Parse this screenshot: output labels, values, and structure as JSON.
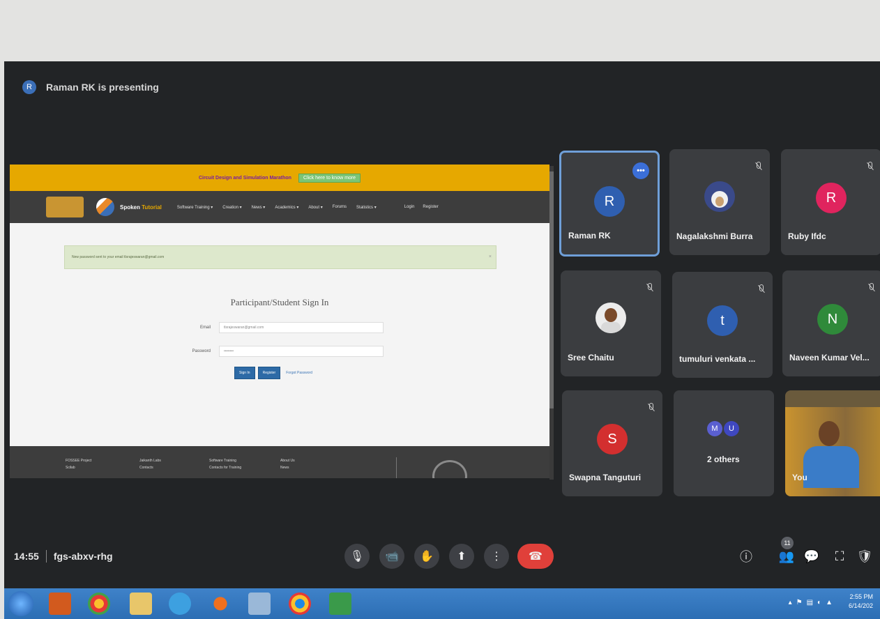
{
  "presenter": {
    "initial": "R",
    "text": "Raman RK is presenting"
  },
  "shared_page": {
    "banner_text": "Circuit Design and Simulation Marathon",
    "banner_button": "Click here to know more",
    "site_name_a": "Spoken",
    "site_name_b": "Tutorial",
    "nav": [
      "Software Training ▾",
      "Creation ▾",
      "News ▾",
      "Academics ▾",
      "About ▾",
      "Forums",
      "Statistics ▾"
    ],
    "nav_right": [
      "Login",
      "Register"
    ],
    "alert_text": "New password sent to your email tlsrajeswaran@gmail.com",
    "signin_title": "Participant/Student Sign In",
    "email_label": "Email",
    "email_value": "tlsrajeswaran@gmail.com",
    "password_label": "Password",
    "password_value": "••••••••",
    "signin_button": "Sign In",
    "register_button": "Register",
    "forgot_link": "Forgot Password",
    "footer_cols": [
      [
        "FOSSEE Project",
        "Scilab"
      ],
      [
        "Jaikanth Labs",
        "Contacts"
      ],
      [
        "Software Training",
        "Contacts for Training"
      ],
      [
        "About Us",
        "News"
      ]
    ]
  },
  "participants": [
    {
      "name": "Raman RK",
      "initial": "R",
      "color": "#2f5fb0",
      "active": true
    },
    {
      "name": "Nagalakshmi Burra",
      "photo": true
    },
    {
      "name": "Ruby Ifdc",
      "initial": "R",
      "color": "#e0245e"
    },
    {
      "name": "Sree Chaitu",
      "photo": true
    },
    {
      "name": "tumuluri venkata ...",
      "initial": "t",
      "color": "#2f5fb0"
    },
    {
      "name": "Naveen Kumar Vel...",
      "initial": "N",
      "color": "#2f8a3a"
    },
    {
      "name": "Swapna Tanguturi",
      "initial": "S",
      "color": "#d32f2f"
    },
    {
      "name": "2 others",
      "badges": [
        "M",
        "U"
      ]
    },
    {
      "name": "You",
      "video": true
    }
  ],
  "meeting": {
    "time": "14:55",
    "code": "fgs-abxv-rhg",
    "participant_count": "11"
  },
  "controls": {
    "mic": "🎙",
    "camera": "📹",
    "hand": "✋",
    "present": "⬆",
    "more": "⋮",
    "end": "☎",
    "info": "ⓘ",
    "people": "👥",
    "chat": "💬",
    "activities": "⛶",
    "host": "🛡"
  },
  "taskbar": {
    "time": "2:55 PM",
    "date": "6/14/202"
  }
}
